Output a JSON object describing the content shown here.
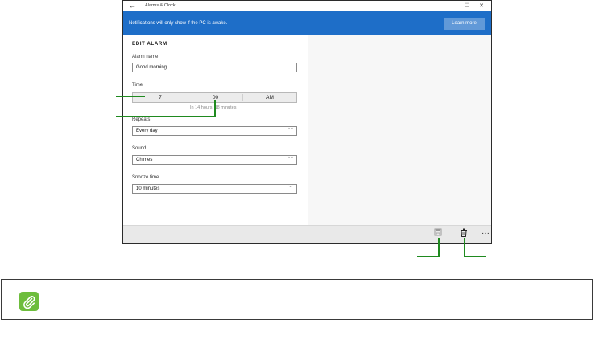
{
  "window": {
    "title": "Alarms & Clock",
    "back_glyph": "←",
    "min_glyph": "—",
    "max_glyph": "☐",
    "close_glyph": "✕"
  },
  "notification": {
    "text": "Notifications will only show if the PC is awake.",
    "button": "Learn more",
    "color": "#1e6ec8"
  },
  "form": {
    "heading": "EDIT ALARM",
    "alarm_name": {
      "label": "Alarm name",
      "value": "Good morning"
    },
    "time": {
      "label": "Time",
      "hour": "7",
      "minute": "00",
      "period": "AM",
      "hint": "In 14 hours, 18 minutes"
    },
    "repeats": {
      "label": "Repeats",
      "value": "Every day"
    },
    "sound": {
      "label": "Sound",
      "value": "Chimes"
    },
    "snooze": {
      "label": "Snooze time",
      "value": "10 minutes"
    }
  },
  "command_bar": {
    "save_icon": "save-icon",
    "delete_icon": "delete-icon",
    "more_glyph": "···"
  },
  "callout_color": "#1f8a1f",
  "note": {
    "icon": "paperclip-icon",
    "icon_color": "#6dbd3c"
  }
}
